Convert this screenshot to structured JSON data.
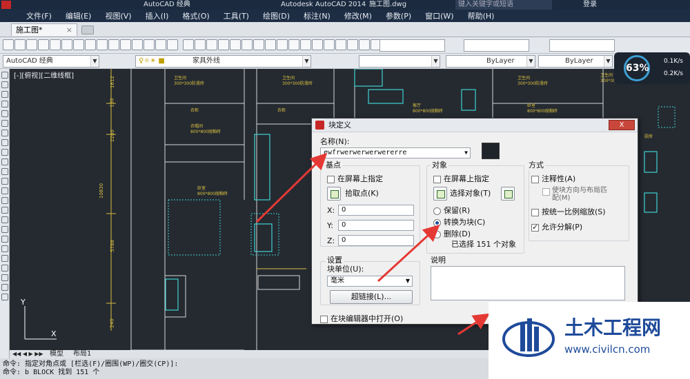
{
  "titlebar": {
    "workspace": "AutoCAD 经典",
    "app_title": "Autodesk AutoCAD 2014",
    "file_name": "施工图.dwg",
    "search_placeholder": "键入关键字或短语",
    "login": "登录"
  },
  "menu": [
    "文件(F)",
    "编辑(E)",
    "视图(V)",
    "插入(I)",
    "格式(O)",
    "工具(T)",
    "绘图(D)",
    "标注(N)",
    "修改(M)",
    "参数(P)",
    "窗口(W)",
    "帮助(H)"
  ],
  "file_tab": {
    "label": "施工图*",
    "close": "×"
  },
  "toolbar2": {
    "workspace_combo": "AutoCAD 经典",
    "layer_combo": "家具外线",
    "linetype_combo": "ByLayer",
    "lineweight_combo": "ByLayer"
  },
  "speed_widget": {
    "percent": "63%",
    "up": "0.1K/s",
    "down": "0.2K/s"
  },
  "viewport_label": "[-][俯视][二维线框]",
  "drawing_labels": [
    {
      "text": "卫生间\n300*300防滑砖"
    },
    {
      "text": "卫生间\n300*300防滑砖"
    },
    {
      "text": "卫生间\n300*300防滑砖"
    },
    {
      "text": "卫生间\n300*300防滑砖"
    },
    {
      "text": "衣柜"
    },
    {
      "text": "衣柜"
    },
    {
      "text": "客厅\n800*800抛釉砖"
    },
    {
      "text": "卧室\n800*800抛釉砖"
    },
    {
      "text": "厨房"
    },
    {
      "text": "衣帽间\n800*800抛釉砖"
    },
    {
      "text": "卧室\n800*800抛釉砖"
    }
  ],
  "dims_left": [
    "1612",
    "150",
    "2200",
    "10830",
    "5788",
    "240"
  ],
  "dialog": {
    "title": "块定义",
    "close": "X",
    "name_label": "名称(N):",
    "name_value": "ewfrwerwerwerwererre",
    "base_group": "基点",
    "base_on_screen": "在屏幕上指定",
    "pick_point": "拾取点(K)",
    "x_label": "X:",
    "y_label": "Y:",
    "z_label": "Z:",
    "x_val": "0",
    "y_val": "0",
    "z_val": "0",
    "object_group": "对象",
    "obj_on_screen": "在屏幕上指定",
    "select_objects": "选择对象(T)",
    "retain": "保留(R)",
    "convert": "转换为块(C)",
    "delete": "删除(D)",
    "selected_count": "已选择 151 个对象",
    "method_group": "方式",
    "annotative": "注释性(A)",
    "match_orientation": "使块方向与布局匹配(M)",
    "scale_uniform": "按统一比例缩放(S)",
    "allow_explode": "允许分解(P)",
    "settings_group": "设置",
    "block_unit_label": "块单位(U):",
    "block_unit_value": "毫米",
    "hyperlink": "超链接(L)...",
    "description_label": "说明",
    "open_in_editor": "在块编辑器中打开(O)"
  },
  "model_tabs": [
    "模型",
    "布局1"
  ],
  "command_lines": [
    "命令: 指定对角点或 [栏选(F)/圈围(WP)/圈交(CP)]:",
    "命令: b BLOCK 找到 151 个"
  ],
  "watermark": {
    "brand": "土木工程网",
    "url": "www.civilcn.com"
  },
  "colors": {
    "accent": "#3ea1d6",
    "drawing_bg": "#252a31",
    "arrow": "#e53935",
    "brand_blue": "#1e4a9a"
  }
}
